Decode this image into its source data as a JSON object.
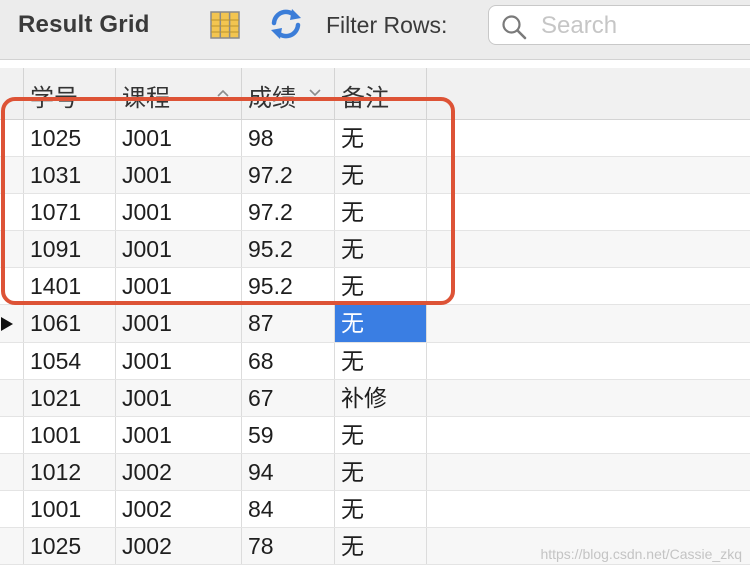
{
  "toolbar": {
    "title": "Result Grid",
    "filter_label": "Filter Rows:",
    "search_placeholder": "Search",
    "icons": {
      "grid": "column-grid-icon",
      "refresh": "refresh-icon",
      "search": "search-icon"
    }
  },
  "grid": {
    "columns": [
      "学号",
      "课程",
      "成绩",
      "备注"
    ],
    "sorted_columns": {
      "课程": "ascending",
      "成绩": "descending"
    },
    "rows": [
      [
        "1025",
        "J001",
        "98",
        "无"
      ],
      [
        "1031",
        "J001",
        "97.2",
        "无"
      ],
      [
        "1071",
        "J001",
        "97.2",
        "无"
      ],
      [
        "1091",
        "J001",
        "95.2",
        "无"
      ],
      [
        "1401",
        "J001",
        "95.2",
        "无"
      ],
      [
        "1061",
        "J001",
        "87",
        "无"
      ],
      [
        "1054",
        "J001",
        "68",
        "无"
      ],
      [
        "1021",
        "J001",
        "67",
        "补修"
      ],
      [
        "1001",
        "J001",
        "59",
        "无"
      ],
      [
        "1012",
        "J002",
        "94",
        "无"
      ],
      [
        "1001",
        "J002",
        "84",
        "无"
      ],
      [
        "1025",
        "J002",
        "78",
        "无"
      ]
    ],
    "current_row": 5,
    "selected_cell": {
      "row": 5,
      "column": "备注"
    },
    "highlighted_rows": [
      0,
      1,
      2,
      3,
      4
    ]
  },
  "colors": {
    "highlight_outline": "#dd5336",
    "selection": "#3a7ee3"
  },
  "watermark": "https://blog.csdn.net/Cassie_zkq"
}
